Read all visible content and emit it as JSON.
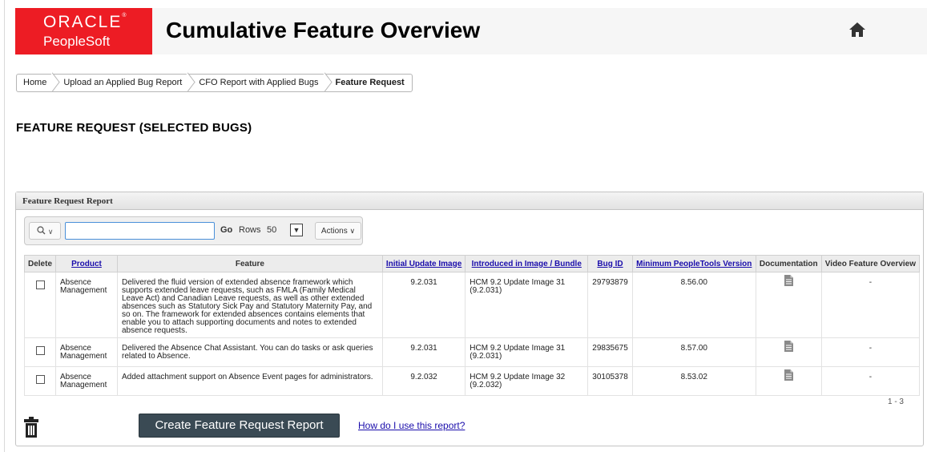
{
  "header": {
    "brand_line1": "ORACLE",
    "brand_line2": "PeopleSoft",
    "title": "Cumulative Feature Overview",
    "home_icon": "home-icon"
  },
  "breadcrumb": [
    "Home",
    "Upload an Applied Bug Report",
    "CFO Report with Applied Bugs",
    "Feature Request"
  ],
  "page_heading": "FEATURE REQUEST (SELECTED BUGS)",
  "region": {
    "title": "Feature Request Report",
    "toolbar": {
      "search_value": "",
      "go_label": "Go",
      "rows_label": "Rows",
      "rows_value": "50",
      "actions_label": "Actions"
    },
    "columns": [
      "Delete",
      "Product",
      "Feature",
      "Initial Update Image",
      "Introduced in Image / Bundle",
      "Bug ID",
      "Minimum PeopleTools Version",
      "Documentation",
      "Video Feature Overview"
    ],
    "rows": [
      {
        "product": "Absence Management",
        "feature": "Delivered the fluid version of extended absence framework which supports extended leave requests, such as FMLA (Family Medical Leave Act) and Canadian Leave requests, as well as other extended absences such as Statutory Sick Pay and Statutory Maternity Pay, and so on. The framework for extended absences contains elements that enable you to attach supporting documents and notes to extended absence requests.",
        "initial_update_image": "9.2.031",
        "introduced": "HCM 9.2 Update Image 31 (9.2.031)",
        "bug_id": "29793879",
        "min_tools": "8.56.00",
        "video": "-"
      },
      {
        "product": "Absence Management",
        "feature": "Delivered the Absence Chat Assistant. You can do tasks or ask queries related to Absence.",
        "initial_update_image": "9.2.031",
        "introduced": "HCM 9.2 Update Image 31 (9.2.031)",
        "bug_id": "29835675",
        "min_tools": "8.57.00",
        "video": "-"
      },
      {
        "product": "Absence Management",
        "feature": "Added attachment support on Absence Event pages for administrators.",
        "initial_update_image": "9.2.032",
        "introduced": "HCM 9.2 Update Image 32 (9.2.032)",
        "bug_id": "30105378",
        "min_tools": "8.53.02",
        "video": "-"
      }
    ],
    "pagination": "1 - 3",
    "create_button": "Create Feature Request Report",
    "help_link": "How do I use this report?"
  },
  "colors": {
    "brand_red": "#ed1c24",
    "button_dark": "#3a4a54",
    "link_blue": "#1a0dab"
  }
}
